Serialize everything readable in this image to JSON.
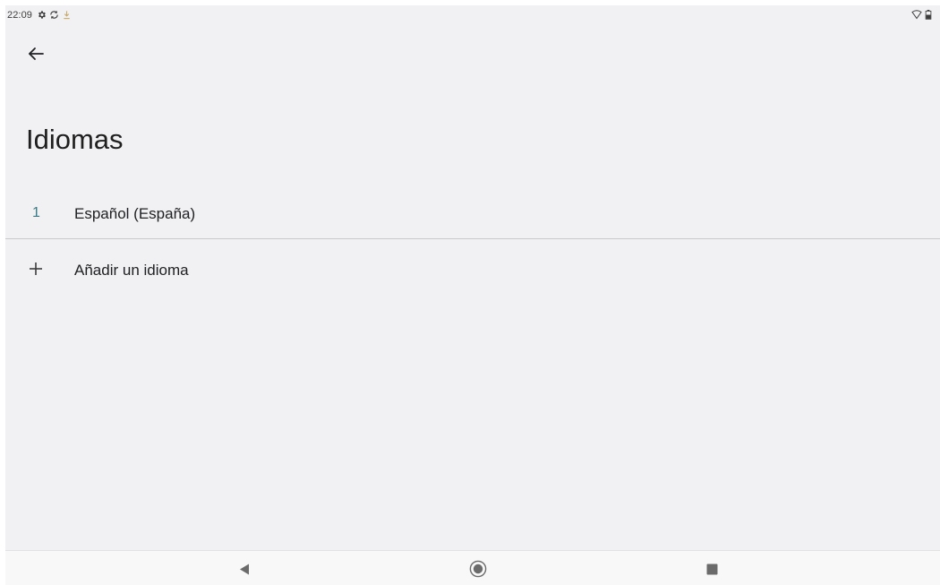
{
  "status_bar": {
    "time": "22:09",
    "left_icons": [
      "gear-icon",
      "sync-icon",
      "download-icon"
    ],
    "right_icons": [
      "wifi-icon",
      "battery-icon"
    ]
  },
  "app_bar": {
    "back_icon": "arrow-back-icon"
  },
  "page": {
    "title": "Idiomas"
  },
  "languages": [
    {
      "index": "1",
      "label": "Español (España)"
    }
  ],
  "add_language": {
    "icon": "plus-icon",
    "label": "Añadir un idioma"
  },
  "nav_bar": {
    "buttons": [
      "back-triangle-icon",
      "home-circle-icon",
      "recents-square-icon"
    ]
  },
  "colors": {
    "background": "#f1f1f3",
    "index_accent": "#3a7a86",
    "text": "#202124",
    "divider": "#c9c9cc"
  }
}
